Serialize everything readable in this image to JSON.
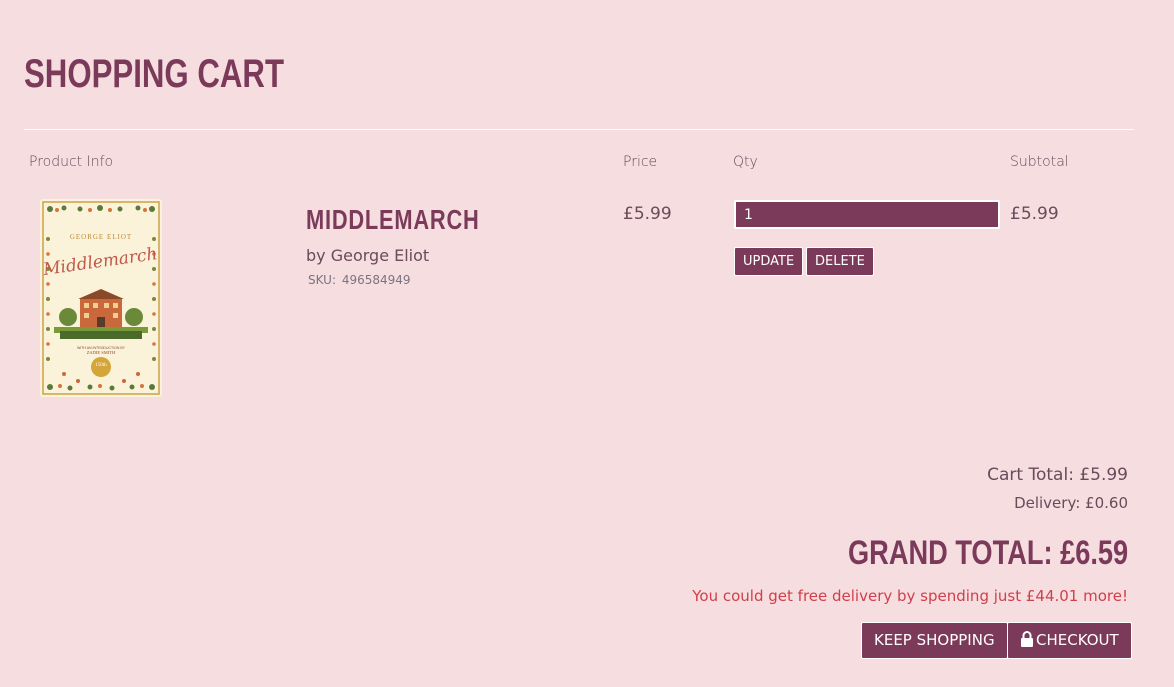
{
  "page": {
    "title": "Shopping Cart"
  },
  "table": {
    "headers": {
      "product": "Product Info",
      "price": "Price",
      "qty": "Qty",
      "subtotal": "Subtotal"
    }
  },
  "item": {
    "name": "Middlemarch",
    "author": "by George Eliot",
    "sku_label": "SKU:",
    "sku": "496584949",
    "price": "£5.99",
    "quantity": "1",
    "subtotal": "£5.99",
    "update_label": "UPDATE",
    "delete_label": "DELETE",
    "cover": {
      "author": "GEORGE ELIOT",
      "title": "Middlemarch",
      "intro": "WITH AN INTRODUCTION BY",
      "intro_author": "ZADIE SMITH",
      "badge": "150th"
    }
  },
  "summary": {
    "cart_total": "Cart Total: £5.99",
    "delivery": "Delivery: £0.60",
    "grand_total": "Grand Total: £6.59",
    "free_delivery_msg": "You could get free delivery by spending just £44.01 more!"
  },
  "actions": {
    "keep_shopping": "KEEP SHOPPING",
    "checkout": "CHECKOUT"
  },
  "colors": {
    "background": "#f5dde0",
    "brand": "#7b3a5a",
    "text": "#6b4a5a",
    "alert": "#d0404a"
  },
  "icons": {
    "checkout": "lock-icon"
  }
}
